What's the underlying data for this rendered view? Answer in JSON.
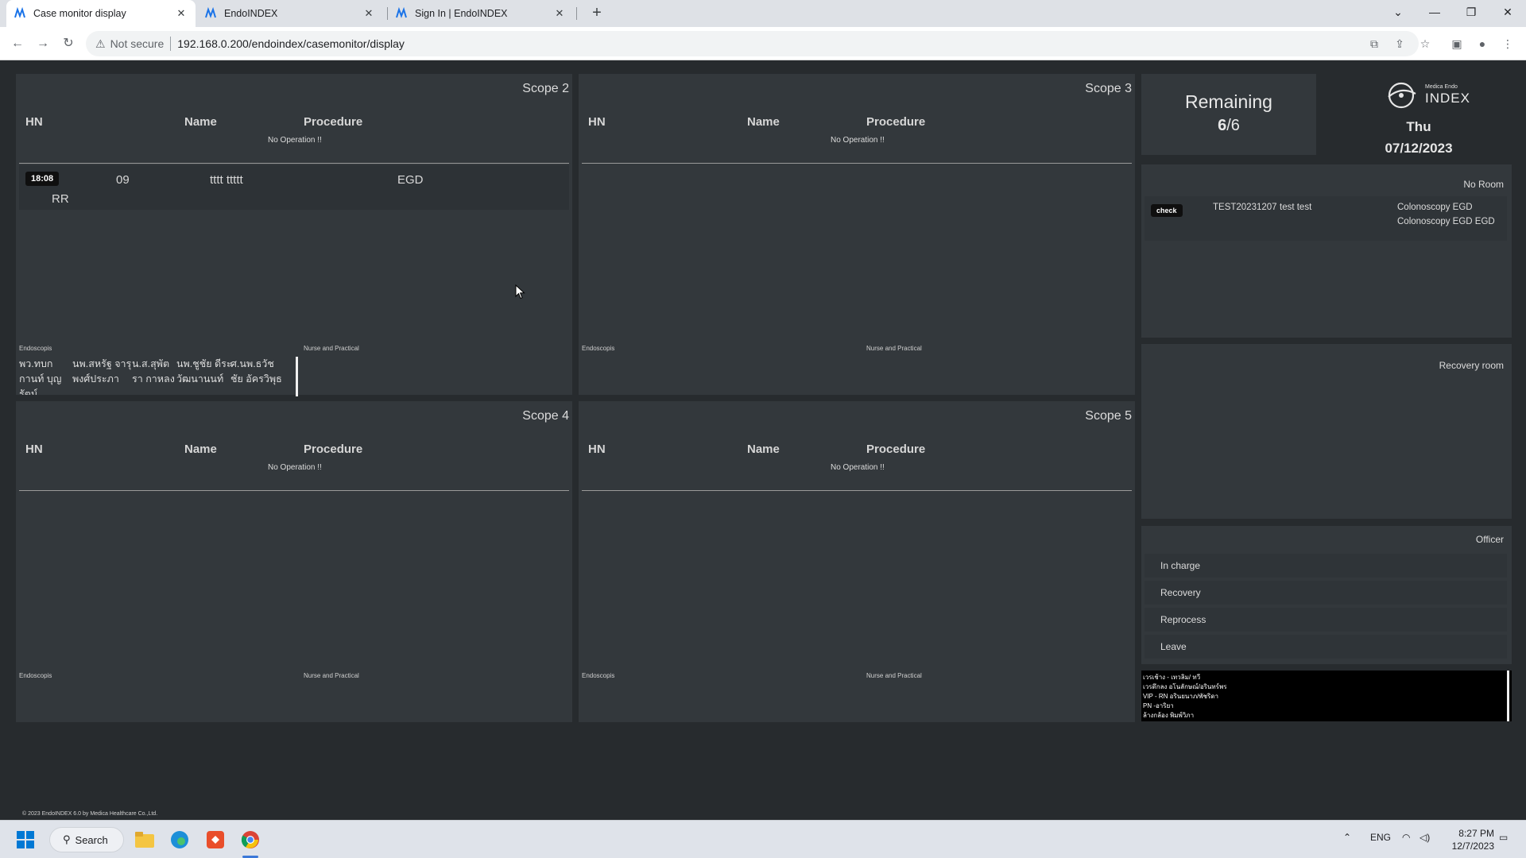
{
  "browser": {
    "tabs": [
      {
        "title": "Case monitor display",
        "active": true
      },
      {
        "title": "EndoINDEX",
        "active": false
      },
      {
        "title": "Sign In | EndoINDEX",
        "active": false
      }
    ],
    "security_label": "Not secure",
    "url": "192.168.0.200/endoindex/casemonitor/display",
    "icons": [
      "back-icon",
      "forward-icon",
      "reload-icon",
      "warning-icon",
      "translate-icon",
      "share-icon",
      "star-icon",
      "sidepanel-icon",
      "profile-icon",
      "menu-icon"
    ]
  },
  "scopes": [
    {
      "title": "Scope 2",
      "headers": {
        "hn": "HN",
        "name": "Name",
        "procedure": "Procedure"
      },
      "no_operation": "No Operation !!",
      "cases": [
        {
          "time": "18:08",
          "hn": "09",
          "name": "tttt ttttt",
          "procedure": "EGD",
          "room": "RR"
        }
      ],
      "endoscopist_label": "Endoscopis",
      "nurse_label": "Nurse and Practical",
      "endoscopists": [
        "พว.ทบก",
        "นพ.สหรัฐ จารุ",
        "น.ส.สุพัต",
        "นพ.ชูชัย ดีระ",
        "ศ.นพ.ธวัช",
        "กานท์ บุญ",
        "พงศ์ประภา",
        "รา กาหลง",
        "วัฒนานนท์",
        "ชัย อัครวิพุธ",
        "รัตน์"
      ]
    },
    {
      "title": "Scope 3",
      "headers": {
        "hn": "HN",
        "name": "Name",
        "procedure": "Procedure"
      },
      "no_operation": "No Operation !!",
      "endoscopist_label": "Endoscopis",
      "nurse_label": "Nurse and Practical"
    },
    {
      "title": "Scope 4",
      "headers": {
        "hn": "HN",
        "name": "Name",
        "procedure": "Procedure"
      },
      "no_operation": "No Operation !!",
      "endoscopist_label": "Endoscopis",
      "nurse_label": "Nurse and Practical"
    },
    {
      "title": "Scope 5",
      "headers": {
        "hn": "HN",
        "name": "Name",
        "procedure": "Procedure"
      },
      "no_operation": "No Operation !!",
      "endoscopist_label": "Endoscopis",
      "nurse_label": "Nurse and Practical"
    }
  ],
  "remaining": {
    "title": "Remaining",
    "done": "6",
    "separator": "/",
    "total": "6"
  },
  "logo": {
    "small": "Medica Endo",
    "big": "INDEX"
  },
  "date": {
    "day": "Thu",
    "date": "07/12/2023"
  },
  "no_room": {
    "title": "No Room",
    "case": {
      "badge": "check",
      "hn": "TEST20231207",
      "name": "test test",
      "procedure_1": "Colonoscopy EGD",
      "procedure_2": "Colonoscopy EGD EGD"
    }
  },
  "recovery_room": {
    "title": "Recovery room"
  },
  "officer": {
    "title": "Officer",
    "rows": [
      "In charge",
      "Recovery",
      "Reprocess",
      "Leave"
    ]
  },
  "notes": [
    "เวรเช้าง - เทวลิม/ ทวี",
    "เวรดึกลง อโนลักษณ์/อรินทร์พร",
    "VIP - RN อรินยนาภ/พัชริดา",
    "PN -อาริยา",
    "ล้างกล้อง พิมพ์วิภา"
  ],
  "footer": {
    "copyright": "© 2023 EndoINDEX 6.0 by Medica Healthcare Co.,Ltd."
  },
  "taskbar": {
    "search_label": "Search",
    "language": "ENG",
    "time": "8:27 PM",
    "date": "12/7/2023",
    "apps": [
      "windows-start-icon",
      "file-explorer-icon",
      "edge-icon",
      "app-icon",
      "chrome-icon"
    ]
  }
}
